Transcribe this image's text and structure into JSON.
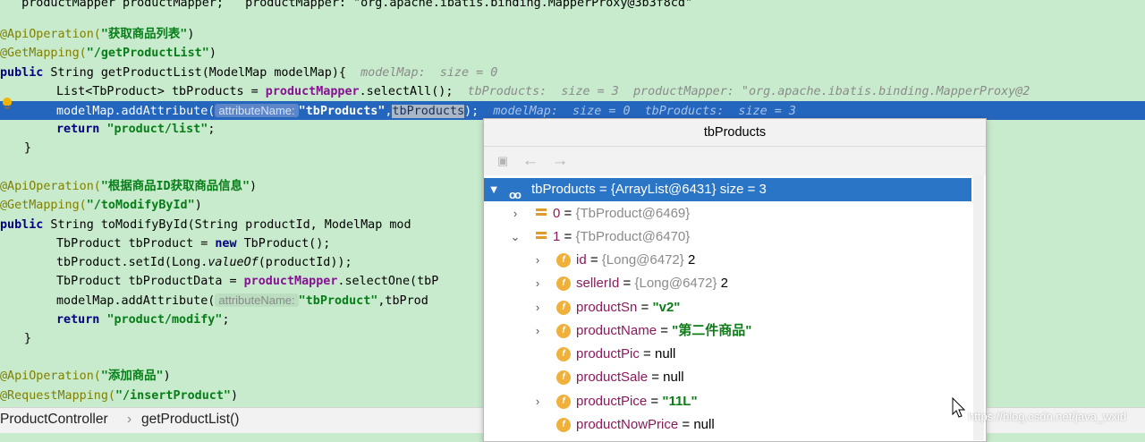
{
  "editor": {
    "l0": "   productMapper productMapper;   productMapper: \"org.apache.ibatis.binding.MapperProxy@3b3f8cd\"",
    "l2": {
      "ann": "@ApiOperation(",
      "str": "\"获取商品列表\"",
      "close": ")"
    },
    "l3": {
      "ann": "@GetMapping(",
      "str": "\"/getProductList\"",
      "close": ")"
    },
    "l4": {
      "kw": "public",
      "code": " String getProductList(ModelMap modelMap){ ",
      "inline": " modelMap:  size = 0"
    },
    "l5": {
      "code": "List<TbProduct> tbProducts = ",
      "fld": "productMapper",
      "code2": ".selectAll();",
      "inline": "  tbProducts:  size = 3  productMapper: \"org.apache.ibatis.binding.MapperProxy@2"
    },
    "l6": {
      "code": "modelMap.addAttribute(",
      "hint": "attributeName:",
      "str": "\"tbProducts\"",
      "comma": ",",
      "sel": "tbProducts",
      "close": ");",
      "inline": "  modelMap:  size = 0  tbProducts:  size = 3"
    },
    "l7": {
      "kw": "return",
      "str": "\"product/list\"",
      "close": ";"
    },
    "l8": "}",
    "l10": {
      "ann": "@ApiOperation(",
      "str": "\"根据商品ID获取商品信息\"",
      "close": ")"
    },
    "l11": {
      "ann": "@GetMapping(",
      "str": "\"/toModifyById\"",
      "close": ")"
    },
    "l12": {
      "kw": "public",
      "code": " String toModifyById(String productId, ModelMap mod"
    },
    "l13": {
      "code": "TbProduct tbProduct = ",
      "kw": "new",
      "code2": " TbProduct();"
    },
    "l14": {
      "code": "tbProduct.setId(Long.",
      "ital": "valueOf",
      "code2": "(productId));"
    },
    "l15": {
      "code": "TbProduct tbProductData = ",
      "fld": "productMapper",
      "code2": ".selectOne(tbP"
    },
    "l16": {
      "code": "modelMap.addAttribute(",
      "hint": "attributeName:",
      "str": "\"tbProduct\"",
      "code2": ",tbProd"
    },
    "l17": {
      "kw": "return",
      "str": "\"product/modify\"",
      "close": ";"
    },
    "l18": "}",
    "l20": {
      "ann": "@ApiOperation(",
      "str": "\"添加商品\"",
      "close": ")"
    },
    "l21": {
      "ann": "@RequestMapping(",
      "str": "\"/insertProduct\"",
      "close": ")"
    }
  },
  "breadcrumb": {
    "items": [
      "ProductController",
      "getProductList()"
    ],
    "separator": "›"
  },
  "popup": {
    "title": "tbProducts",
    "tree": [
      {
        "name": "tbProducts",
        "eq": " = ",
        "ref": "{ArrayList@6431}",
        "value": " size = 3"
      },
      {
        "name": "0",
        "eq": " = ",
        "ref": "{TbProduct@6469}"
      },
      {
        "name": "1",
        "eq": " = ",
        "ref": "{TbProduct@6470}"
      },
      {
        "name": "id",
        "eq": " = ",
        "ref": "{Long@6472}",
        "value": " 2"
      },
      {
        "name": "sellerId",
        "eq": " = ",
        "ref": "{Long@6472}",
        "value": " 2"
      },
      {
        "name": "productSn",
        "eq": " = ",
        "value": "\"v2\""
      },
      {
        "name": "productName",
        "eq": " = ",
        "value": "\"第二件商品\""
      },
      {
        "name": "productPic",
        "eq": " = ",
        "value": "null"
      },
      {
        "name": "productSale",
        "eq": " = ",
        "value": "null"
      },
      {
        "name": "productPice",
        "eq": " = ",
        "value": "\"11L\""
      },
      {
        "name": "productNowPrice",
        "eq": " = ",
        "value": "null"
      }
    ]
  },
  "watermark": "https://blog.csdn.net/java_wxid"
}
